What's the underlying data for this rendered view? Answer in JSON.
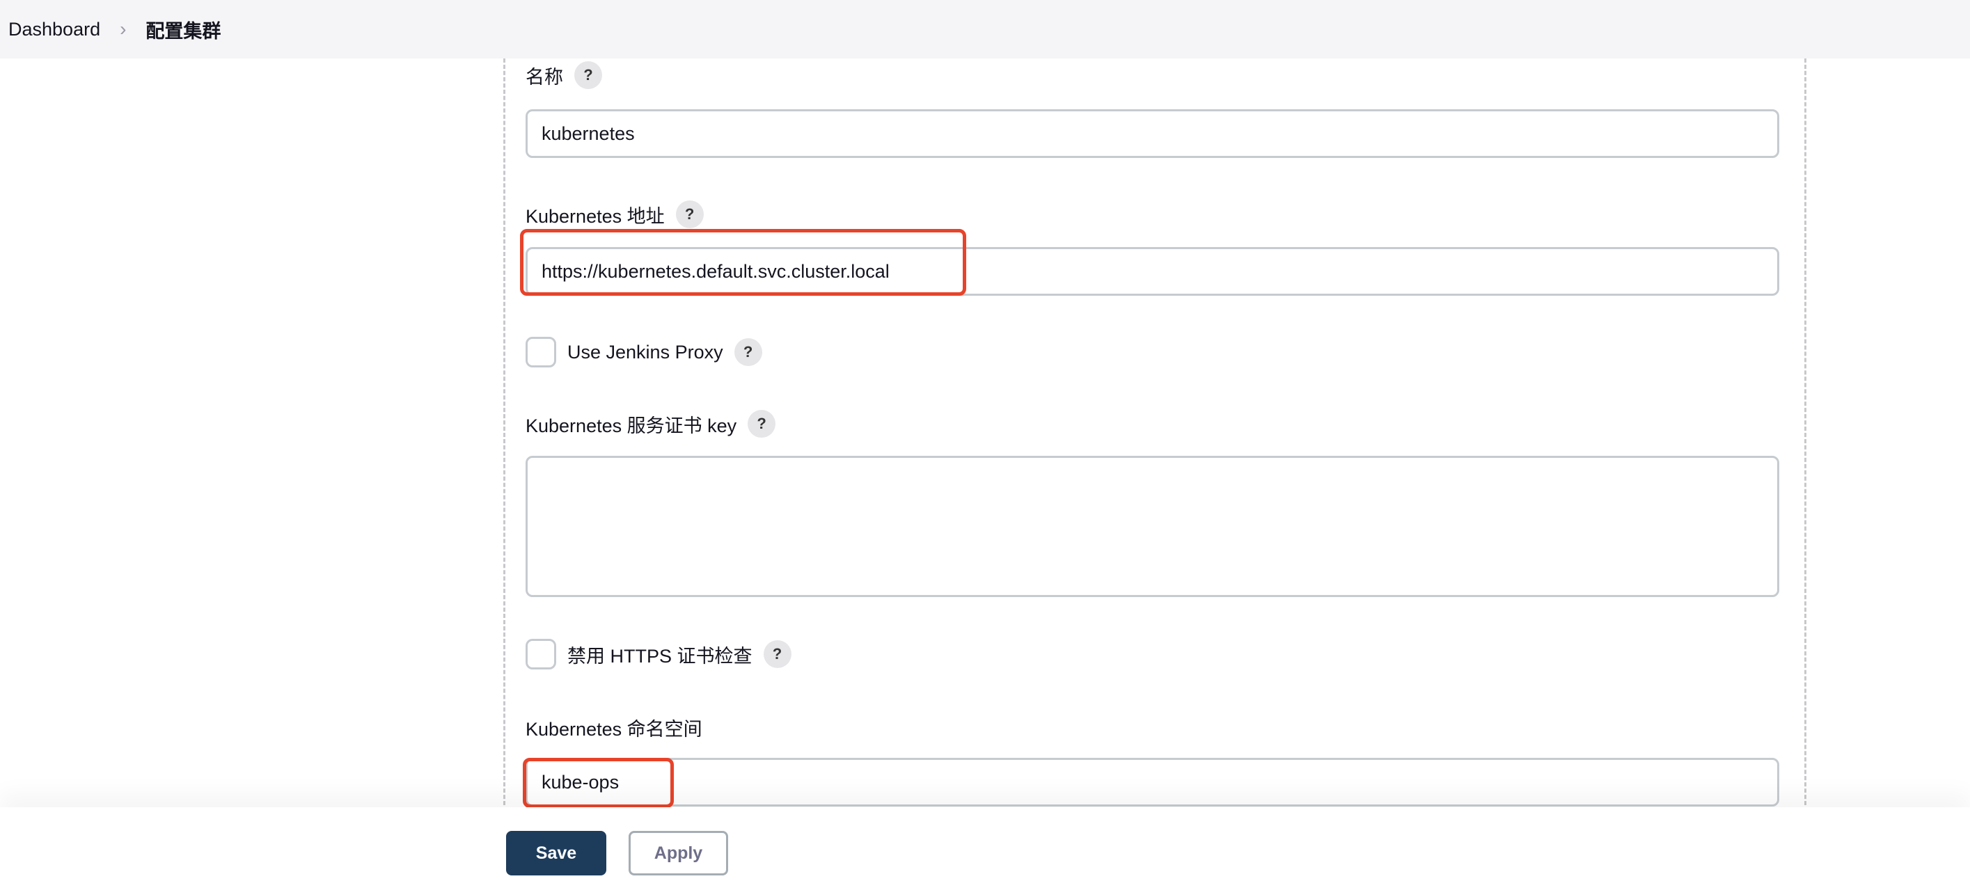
{
  "breadcrumb": {
    "items": [
      "Dashboard",
      "配置集群"
    ],
    "separator": "›"
  },
  "form": {
    "name": {
      "label": "名称",
      "value": "kubernetes"
    },
    "k8s_url": {
      "label": "Kubernetes 地址",
      "value": "https://kubernetes.default.svc.cluster.local"
    },
    "use_proxy": {
      "label": "Use Jenkins Proxy",
      "checked": false
    },
    "server_cert": {
      "label": "Kubernetes 服务证书 key",
      "value": ""
    },
    "skip_tls": {
      "label": "禁用 HTTPS 证书检查",
      "checked": false
    },
    "namespace": {
      "label": "Kubernetes 命名空间",
      "value": "kube-ops"
    },
    "help_glyph": "?"
  },
  "actions": {
    "save": "Save",
    "apply": "Apply"
  },
  "colors": {
    "highlight": "#e8432a",
    "primary": "#1d3c5c"
  }
}
